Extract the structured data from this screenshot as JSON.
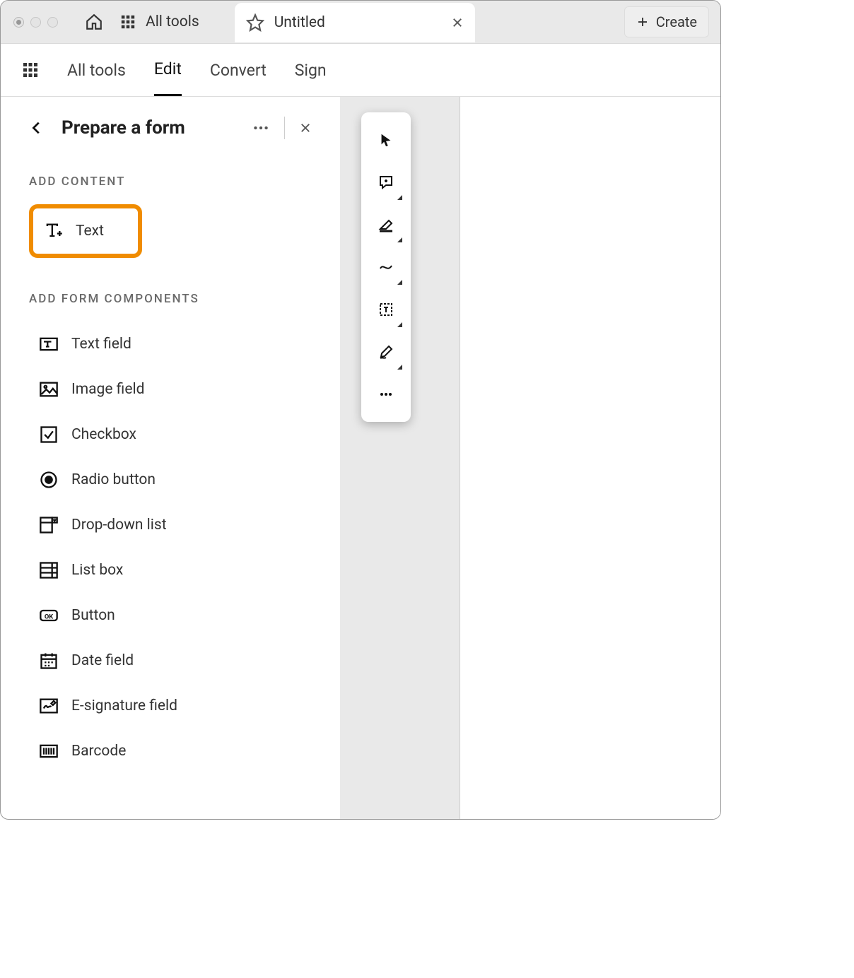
{
  "titlebar": {
    "all_tools": "All tools",
    "doc_title": "Untitled",
    "create": "Create"
  },
  "menubar": {
    "all_tools": "All tools",
    "edit": "Edit",
    "convert": "Convert",
    "sign": "Sign"
  },
  "panel": {
    "title": "Prepare a form",
    "add_content_label": "ADD CONTENT",
    "add_form_label": "ADD FORM COMPONENTS",
    "tools": {
      "text": "Text",
      "text_field": "Text field",
      "image_field": "Image field",
      "checkbox": "Checkbox",
      "radio": "Radio button",
      "dropdown": "Drop-down list",
      "listbox": "List box",
      "button": "Button",
      "date": "Date field",
      "esign": "E-signature field",
      "barcode": "Barcode"
    }
  }
}
